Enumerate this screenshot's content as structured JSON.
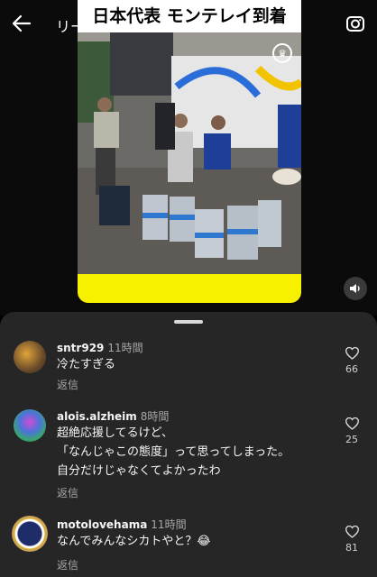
{
  "header": {
    "title": "リー",
    "back_icon": "arrow-left-icon",
    "camera_icon": "camera-icon"
  },
  "video": {
    "headline": "日本代表 モンテレイ到着",
    "volume_icon": "speaker-icon",
    "accent_color": "#f7f100"
  },
  "comments": [
    {
      "username": "sntr929",
      "time": "11時間",
      "lines": [
        "冷たすぎる"
      ],
      "reply": "返信",
      "likes": "66"
    },
    {
      "username": "alois.alzheim",
      "time": "8時間",
      "lines": [
        "超絶応援してるけど、",
        "「なんじゃこの態度」って思ってしまった。",
        "自分だけじゃなくてよかったわ"
      ],
      "reply": "返信",
      "likes": "25"
    },
    {
      "username": "motolovehama",
      "time": "11時間",
      "lines": [
        "なんでみんなシカトやと？😂"
      ],
      "reply": "返信",
      "likes": "81"
    }
  ]
}
